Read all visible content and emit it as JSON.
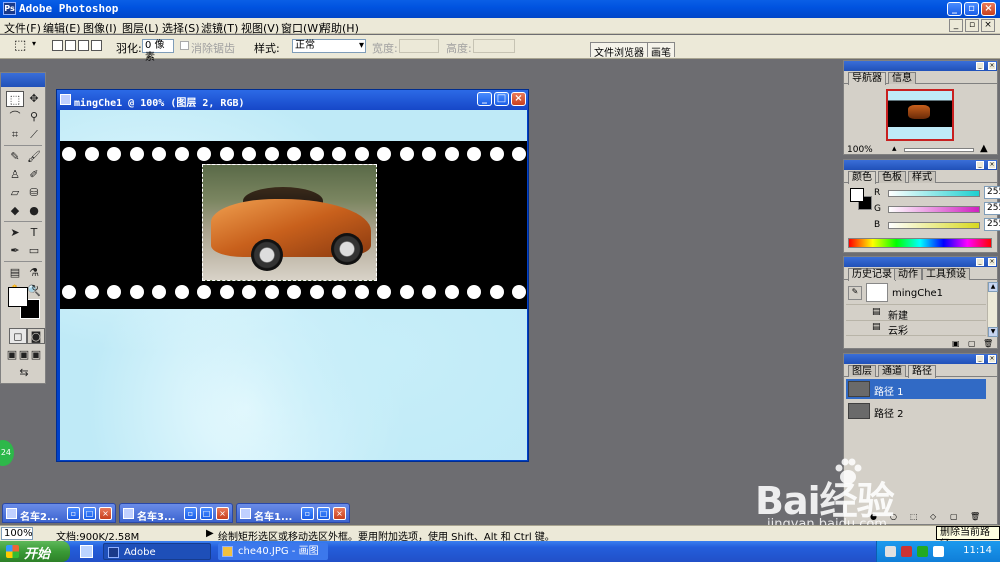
{
  "window": {
    "title": "Adobe Photoshop",
    "app_icon_text": "Ps"
  },
  "menu": {
    "items": [
      "文件(F)",
      "编辑(E)",
      "图像(I)",
      "图层(L)",
      "选择(S)",
      "滤镜(T)",
      "视图(V)",
      "窗口(W)",
      "帮助(H)"
    ]
  },
  "options": {
    "feather_label": "羽化:",
    "feather_value": "0 像素",
    "antialias_label": "消除锯齿",
    "style_label": "样式:",
    "style_value": "正常",
    "width_label": "宽度:",
    "height_label": "高度:",
    "tab_file_browser": "文件浏览器",
    "tab_brushes": "画笔"
  },
  "document": {
    "title": "mingChe1 @ 100% (图层 2, RGB)"
  },
  "minimized_windows": [
    {
      "title": "名车2..."
    },
    {
      "title": "名车3..."
    },
    {
      "title": "名车1..."
    }
  ],
  "status": {
    "zoom": "100%",
    "doc_info": "文档:900K/2.58M",
    "hint": "绘制矩形选区或移动选区外框。要用附加选项，使用 Shift、Alt 和 Ctrl 键。"
  },
  "navigator": {
    "tabs": [
      "导航器",
      "信息"
    ],
    "zoom": "100%"
  },
  "color_panel": {
    "tabs": [
      "颜色",
      "色板",
      "样式"
    ],
    "channels": [
      {
        "label": "R",
        "value": "255",
        "color": "#1ed0d0"
      },
      {
        "label": "G",
        "value": "255",
        "color": "#d020c0"
      },
      {
        "label": "B",
        "value": "255",
        "color": "#d8d820"
      }
    ]
  },
  "history_panel": {
    "tabs": [
      "历史记录",
      "动作",
      "工具预设"
    ],
    "snapshot": "mingChe1",
    "items": [
      "新建",
      "云彩"
    ]
  },
  "layers_panel": {
    "tabs": [
      "图层",
      "通道",
      "路径"
    ],
    "paths": [
      "路径 1",
      "路径 2"
    ]
  },
  "tooltip": {
    "text": "删除当前路径"
  },
  "taskbar": {
    "start": "开始",
    "tasks": [
      "Adobe Photoshop",
      "che40.JPG - 画图"
    ],
    "clock": "11:14"
  },
  "badge": {
    "text": "24"
  },
  "watermark": {
    "brand": "Bai经验",
    "url": "jingyan.baidu.com"
  },
  "colors": {
    "titlebar": "#0053e0",
    "selected_row": "#316ac5",
    "canvas_sky": "#bfeaf7"
  }
}
